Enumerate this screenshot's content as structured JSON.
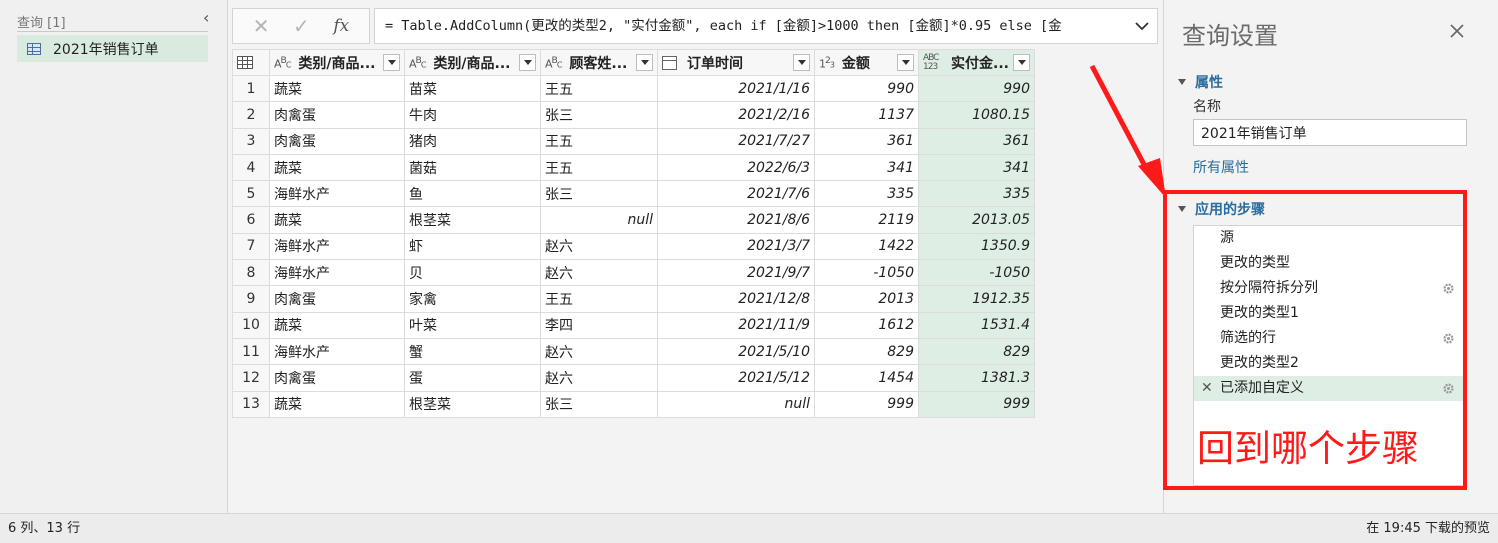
{
  "queries": {
    "header": "查询 [1]",
    "items": [
      {
        "label": "2021年销售订单",
        "icon": "table-icon"
      }
    ]
  },
  "formula": {
    "text": "= Table.AddColumn(更改的类型2, \"实付金额\", each if [金额]>1000 then [金额]*0.95 else [金",
    "fx": "fx"
  },
  "grid": {
    "columns": [
      {
        "type_icon": "ABC",
        "label": "类别/商品..."
      },
      {
        "type_icon": "ABC",
        "label": "类别/商品..."
      },
      {
        "type_icon": "ABC",
        "label": "顾客姓..."
      },
      {
        "type_icon": "calendar",
        "label": "订单时间"
      },
      {
        "type_icon": "123",
        "label": "金额"
      },
      {
        "type_icon": "ABC123",
        "label": "实付金..."
      }
    ],
    "rows": [
      [
        "1",
        "蔬菜",
        "苗菜",
        "王五",
        "2021/1/16",
        "990",
        "990"
      ],
      [
        "2",
        "肉禽蛋",
        "牛肉",
        "张三",
        "2021/2/16",
        "1137",
        "1080.15"
      ],
      [
        "3",
        "肉禽蛋",
        "猪肉",
        "王五",
        "2021/7/27",
        "361",
        "361"
      ],
      [
        "4",
        "蔬菜",
        "菌菇",
        "王五",
        "2022/6/3",
        "341",
        "341"
      ],
      [
        "5",
        "海鲜水产",
        "鱼",
        "张三",
        "2021/7/6",
        "335",
        "335"
      ],
      [
        "6",
        "蔬菜",
        "根茎菜",
        "null",
        "2021/8/6",
        "2119",
        "2013.05"
      ],
      [
        "7",
        "海鲜水产",
        "虾",
        "赵六",
        "2021/3/7",
        "1422",
        "1350.9"
      ],
      [
        "8",
        "海鲜水产",
        "贝",
        "赵六",
        "2021/9/7",
        "-1050",
        "-1050"
      ],
      [
        "9",
        "肉禽蛋",
        "家禽",
        "王五",
        "2021/12/8",
        "2013",
        "1912.35"
      ],
      [
        "10",
        "蔬菜",
        "叶菜",
        "李四",
        "2021/11/9",
        "1612",
        "1531.4"
      ],
      [
        "11",
        "海鲜水产",
        "蟹",
        "赵六",
        "2021/5/10",
        "829",
        "829"
      ],
      [
        "12",
        "肉禽蛋",
        "蛋",
        "赵六",
        "2021/5/12",
        "1454",
        "1381.3"
      ],
      [
        "13",
        "蔬菜",
        "根茎菜",
        "张三",
        "null",
        "999",
        "999"
      ]
    ]
  },
  "settings": {
    "title": "查询设置",
    "properties_heading": "属性",
    "name_label": "名称",
    "name_value": "2021年销售订单",
    "all_properties": "所有属性",
    "steps_heading": "应用的步骤",
    "steps": [
      {
        "label": "源",
        "has_gear": false,
        "selected": false
      },
      {
        "label": "更改的类型",
        "has_gear": false,
        "selected": false
      },
      {
        "label": "按分隔符拆分列",
        "has_gear": true,
        "selected": false
      },
      {
        "label": "更改的类型1",
        "has_gear": false,
        "selected": false
      },
      {
        "label": "筛选的行",
        "has_gear": true,
        "selected": false
      },
      {
        "label": "更改的类型2",
        "has_gear": false,
        "selected": false
      },
      {
        "label": "已添加自定义",
        "has_gear": true,
        "selected": true
      }
    ]
  },
  "annotation": {
    "text": "回到哪个步骤",
    "color": "#ff1a1a"
  },
  "status": {
    "left": "6 列、13 行",
    "right": "在 19:45 下载的预览"
  },
  "colors": {
    "accent_blue": "#2a6d9f",
    "selected_green": "#dfeee4"
  }
}
